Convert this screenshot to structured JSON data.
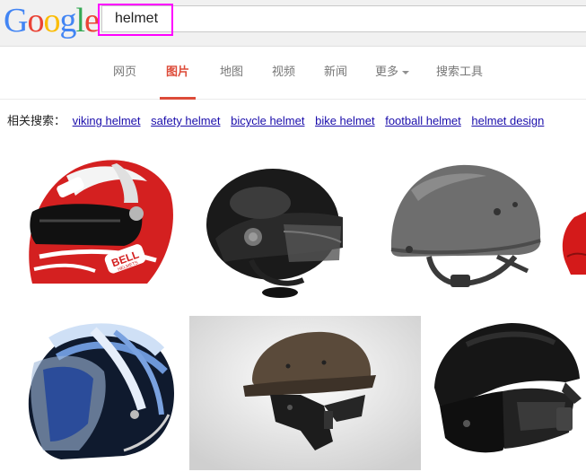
{
  "logo": {
    "letters": [
      "G",
      "o",
      "o",
      "g",
      "l",
      "e"
    ],
    "colors": [
      "#4285f4",
      "#ea4335",
      "#fbbc05",
      "#4285f4",
      "#34a853",
      "#ea4335"
    ]
  },
  "search": {
    "value": "helmet",
    "highlight_color": "#ff00ff"
  },
  "tabs": [
    {
      "label": "网页",
      "active": false
    },
    {
      "label": "图片",
      "active": true
    },
    {
      "label": "地图",
      "active": false
    },
    {
      "label": "视频",
      "active": false
    },
    {
      "label": "新闻",
      "active": false
    },
    {
      "label": "更多",
      "active": false,
      "has_caret": true
    },
    {
      "label": "搜索工具",
      "active": false
    }
  ],
  "related": {
    "label": "相关搜索：",
    "items": [
      "viking helmet",
      "safety helmet",
      "bicycle helmet",
      "bike helmet",
      "football helmet",
      "helmet design"
    ]
  },
  "images": [
    {
      "subject": "red full-face motorcycle helmet",
      "brand_text": "BELL",
      "brand_sub": "HELMETS"
    },
    {
      "subject": "black open-face helmet with visor"
    },
    {
      "subject": "grey military combat helmet"
    },
    {
      "subject": "partially visible red helmet"
    },
    {
      "subject": "blue and white striped motorcycle helmet with clear visor"
    },
    {
      "subject": "brown half helmet with black jaw guard"
    },
    {
      "subject": "matte black motocross helmet"
    }
  ],
  "colors": {
    "active_tab": "#dd4b39",
    "link": "#1a0dab",
    "tab_text": "#777777"
  }
}
